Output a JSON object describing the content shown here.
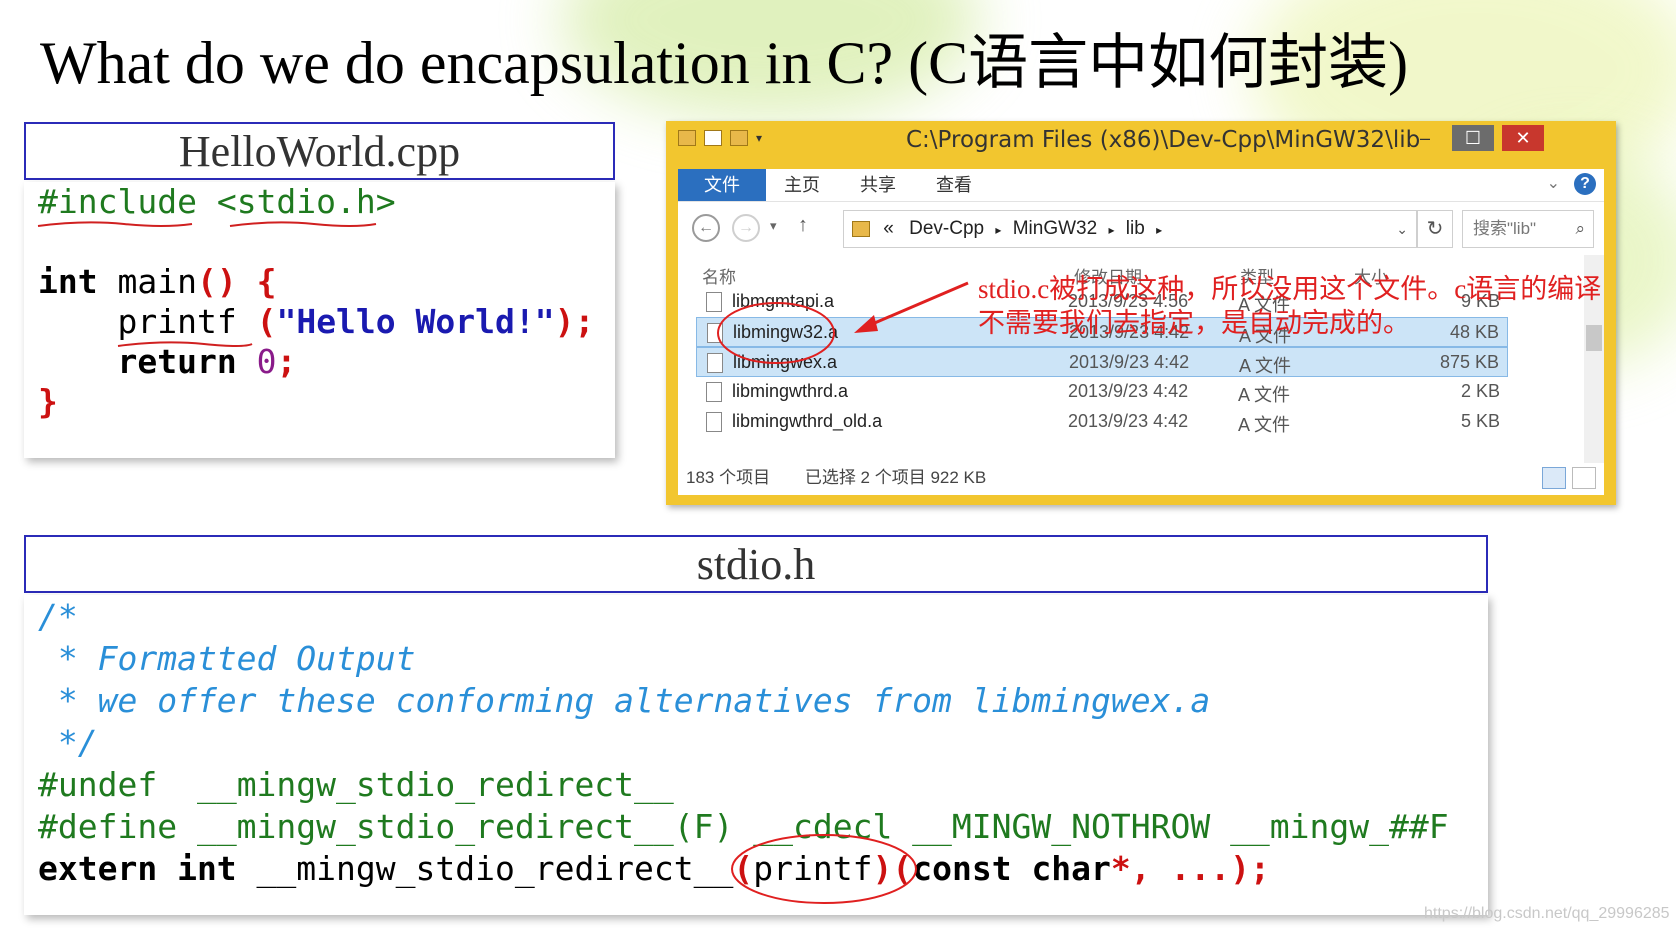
{
  "slide": {
    "title": "What do we do encapsulation in C? (C语言中如何封装)"
  },
  "helloworld": {
    "header": "HelloWorld.cpp",
    "include_directive": "#include",
    "include_file": "<stdio.h>",
    "int_kw": "int",
    "main_sig": " main",
    "main_parens": "()",
    "open_brace": "{",
    "printf": "printf",
    "printf_open": " (",
    "printf_arg": "\"Hello World!\"",
    "printf_close": ");",
    "return_kw": "return",
    "return_val": "0",
    "semicolon": ";",
    "close_brace": "}"
  },
  "explorer": {
    "window_title": "C:\\Program Files (x86)\\Dev-Cpp\\MinGW32\\lib",
    "ribbon_tabs": [
      "文件",
      "主页",
      "共享",
      "查看"
    ],
    "breadcrumb": [
      "«",
      "Dev-Cpp",
      "MinGW32",
      "lib"
    ],
    "search_placeholder": "搜索\"lib\"",
    "columns": {
      "name": "名称",
      "date": "修改日期",
      "type": "类型",
      "size": "大小"
    },
    "files": [
      {
        "name": "libmgmtapi.a",
        "date": "2013/9/23 4:56",
        "type": "A 文件",
        "size": "9 KB",
        "selected": false
      },
      {
        "name": "libmingw32.a",
        "date": "2013/9/23 4:42",
        "type": "A 文件",
        "size": "48 KB",
        "selected": true
      },
      {
        "name": "libmingwex.a",
        "date": "2013/9/23 4:42",
        "type": "A 文件",
        "size": "875 KB",
        "selected": true
      },
      {
        "name": "libmingwthrd.a",
        "date": "2013/9/23 4:42",
        "type": "A 文件",
        "size": "2 KB",
        "selected": false
      },
      {
        "name": "libmingwthrd_old.a",
        "date": "2013/9/23 4:42",
        "type": "A 文件",
        "size": "5 KB",
        "selected": false
      }
    ],
    "status": {
      "count": "183 个项目",
      "selected": "已选择 2 个项目  922 KB"
    }
  },
  "annotation": {
    "line1": "stdio.c被打成这种，所以没用这个文件。c语言的编译",
    "line2": "不需要我们去指定，是自动完成的。"
  },
  "stdio": {
    "header": "stdio.h",
    "c1": "/*",
    "c2": " * Formatted Output",
    "c3": " * we offer these conforming alternatives from libmingwex.a",
    "c4": " */",
    "undef_kw": "#undef",
    "undef_name": "  __mingw_stdio_redirect__",
    "define_kw": "#define",
    "define_rest": " __mingw_stdio_redirect__(F) __cdecl __MINGW_NOTHROW __mingw_##F",
    "extern_kw": "extern int",
    "extern_name": " __mingw_stdio_redirect__",
    "extern_open": "(",
    "extern_printf": "printf",
    "extern_close": ")(",
    "extern_const": "const char",
    "extern_star": "*",
    "extern_rest": ", ...);"
  },
  "watermark": "https://blog.csdn.net/qq_29996285"
}
